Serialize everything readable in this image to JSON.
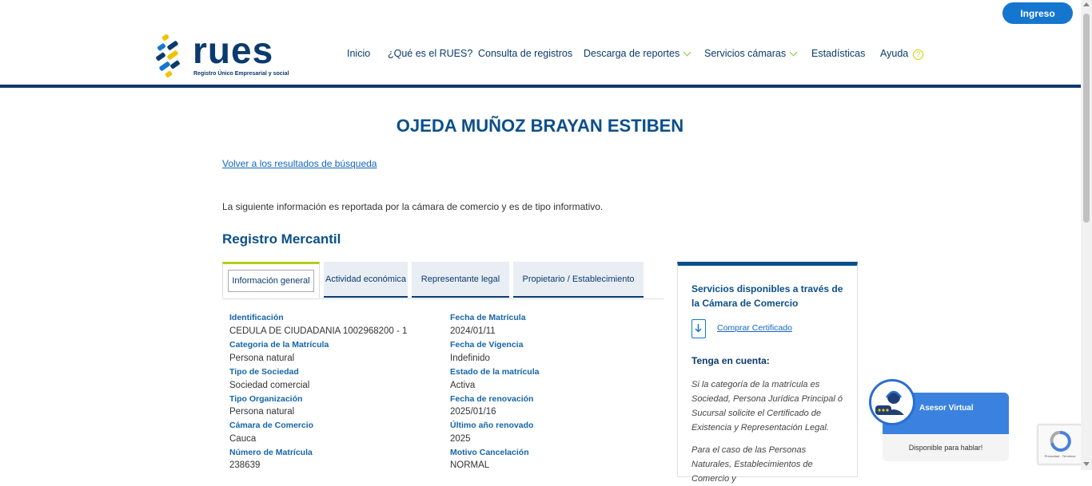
{
  "header": {
    "logo_word": "rues",
    "logo_sub": "Registro Único Empresarial y social",
    "login_label": "Ingreso",
    "nav": [
      {
        "label": "Inicio"
      },
      {
        "label": "¿Qué es el RUES?"
      },
      {
        "label": "Consulta de registros"
      },
      {
        "label": "Descarga de reportes"
      },
      {
        "label": "Servicios cámaras"
      },
      {
        "label": "Estadísticas"
      },
      {
        "label": "Ayuda"
      }
    ],
    "help_glyph": "?"
  },
  "main": {
    "title": "OJEDA MUÑOZ BRAYAN ESTIBEN",
    "back_link": "Volver a los resultados de búsqueda",
    "info_text": "La siguiente información es reportada por la cámara de comercio y es de tipo informativo.",
    "section_title": "Registro Mercantil",
    "tabs": [
      {
        "label": "Información general"
      },
      {
        "label": "Actividad económica"
      },
      {
        "label": "Representante legal"
      },
      {
        "label": "Propietario / Establecimiento"
      }
    ],
    "fields_left": [
      {
        "label": "Identificación",
        "value": "CEDULA DE CIUDADANIA 1002968200 - 1"
      },
      {
        "label": "Categoria de la Matrícula",
        "value": "Persona natural"
      },
      {
        "label": "Tipo de Sociedad",
        "value": "Sociedad comercial"
      },
      {
        "label": "Tipo Organización",
        "value": "Persona natural"
      },
      {
        "label": "Cámara de Comercio",
        "value": "Cauca"
      },
      {
        "label": "Número de Matrícula",
        "value": "238639"
      }
    ],
    "fields_right": [
      {
        "label": "Fecha de Matrícula",
        "value": "2024/01/11"
      },
      {
        "label": "Fecha de Vigencia",
        "value": "Indefinido"
      },
      {
        "label": "Estado de la matrícula",
        "value": "Activa"
      },
      {
        "label": "Fecha de renovación",
        "value": "2025/01/16"
      },
      {
        "label": "Último año renovado",
        "value": "2025"
      },
      {
        "label": "Motivo Cancelación",
        "value": "NORMAL"
      }
    ]
  },
  "sidebar": {
    "title": "Servicios disponibles a través de la Cámara de Comercio",
    "cert_link": "Comprar Certificado",
    "note_title": "Tenga en cuenta:",
    "note_p1": "Si la categoría de la matrícula es Sociedad, Persona Jurídica Principal ó Sucursal solicite el Certificado de Existencia y Representación Legal.",
    "note_p2": "Para el caso de las Personas Naturales, Establecimientos de Comercio y"
  },
  "chat": {
    "label": "Asesor Virtual",
    "status": "Disponible para hablar!"
  },
  "recaptcha": {
    "text": "Privacidad - Términos"
  },
  "colors": {
    "brand_dark": "#0b3a6e",
    "brand_blue": "#1576d0",
    "accent_green": "#b5cc18"
  }
}
